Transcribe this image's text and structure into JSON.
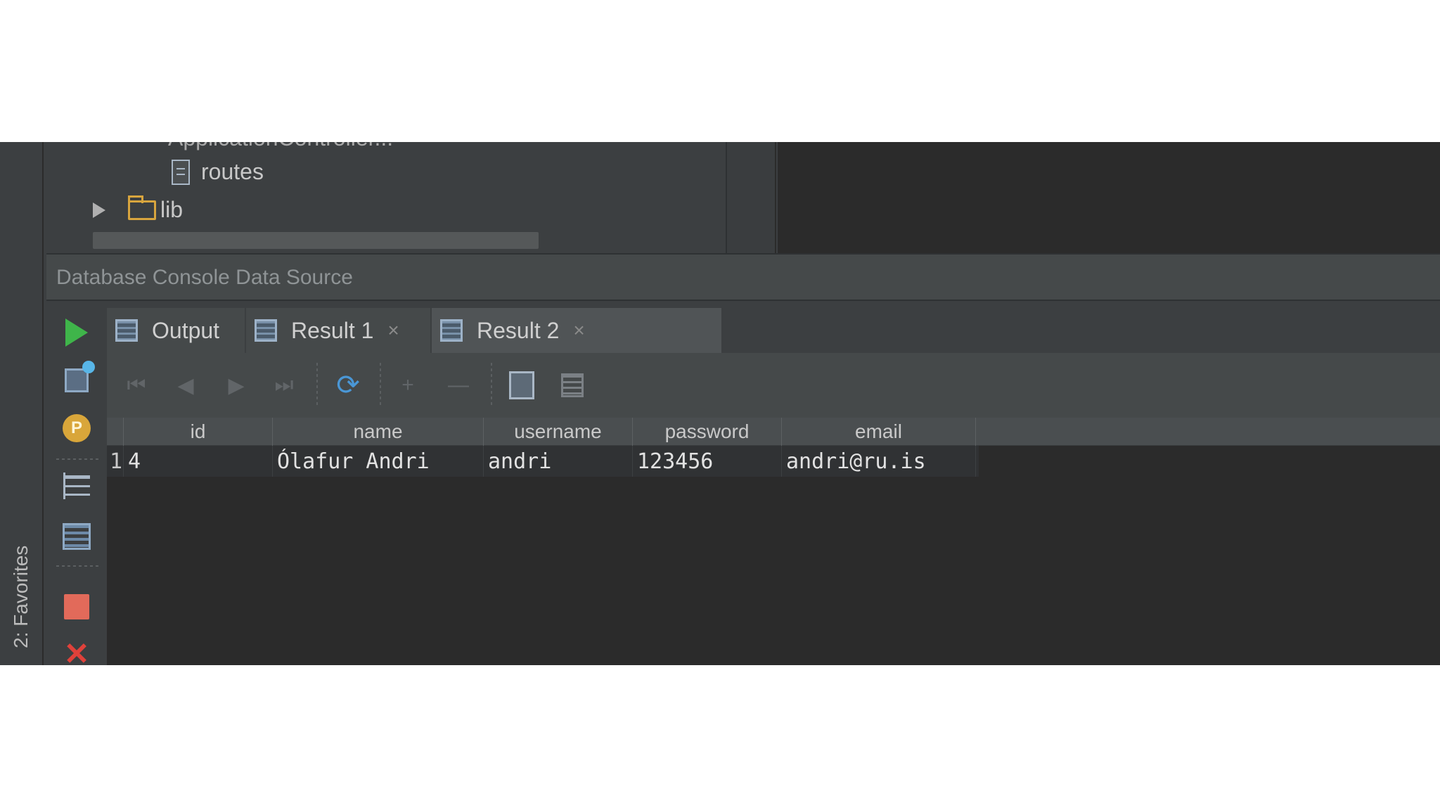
{
  "project_tree": {
    "cut_off_item": "ApplicationController...",
    "routes_label": "routes",
    "lib_label": "lib"
  },
  "db_panel": {
    "header_title": "Database Console Data Source"
  },
  "left_strip": {
    "favorites_label": "2: Favorites"
  },
  "tabs": [
    {
      "label": "Output",
      "closable": false
    },
    {
      "label": "Result 1",
      "closable": true
    },
    {
      "label": "Result 2",
      "closable": true
    }
  ],
  "tab_close_glyph": "×",
  "grid_toolbar": {
    "first_glyph": "⏮",
    "prev_glyph": "◀",
    "next_glyph": "▶",
    "last_glyph": "⏭",
    "refresh_glyph": "⟳",
    "add_glyph": "+",
    "remove_glyph": "—"
  },
  "result_grid": {
    "columns": [
      "id",
      "name",
      "username",
      "password",
      "email"
    ],
    "rows": [
      {
        "row_num": "1",
        "id": "4",
        "name": "Ólafur Andri",
        "username": "andri",
        "password": "123456",
        "email": "andri@ru.is"
      }
    ]
  },
  "colors": {
    "run_green": "#3fb54a",
    "stop_red": "#e26a5a",
    "close_red": "#e0413a",
    "refresh_blue": "#4a97d6",
    "panel_bg": "#3c3f41",
    "grid_bg": "#2b2b2b"
  },
  "icons": {
    "run": "run-icon",
    "console": "console-icon",
    "p": "p-badge-icon",
    "tree": "tree-icon",
    "layout": "layout-icon",
    "stop": "stop-icon",
    "close": "close-icon"
  }
}
